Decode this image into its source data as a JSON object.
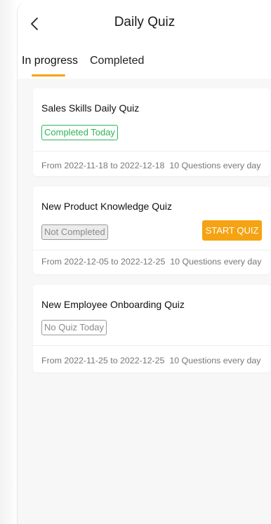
{
  "header": {
    "title": "Daily Quiz"
  },
  "tabs": [
    {
      "label": "In progress",
      "active": true
    },
    {
      "label": "Completed",
      "active": false
    }
  ],
  "colors": {
    "accent": "#f5a312",
    "success": "#2fb35a",
    "muted": "#8a8a8a"
  },
  "quizzes": [
    {
      "title": "Sales Skills Daily Quiz",
      "status": "Completed Today",
      "period": "From 2022-11-18 to 2022-12-18",
      "questions": "10 Questions every day"
    },
    {
      "title": "New Product Knowledge Quiz",
      "status": "Not Completed",
      "action": "START QUIZ",
      "period": "From 2022-12-05 to 2022-12-25",
      "questions": "10 Questions every day"
    },
    {
      "title": "New Employee Onboarding Quiz",
      "status": "No Quiz Today",
      "period": "From 2022-11-25 to 2022-12-25",
      "questions": "10 Questions every day"
    }
  ]
}
